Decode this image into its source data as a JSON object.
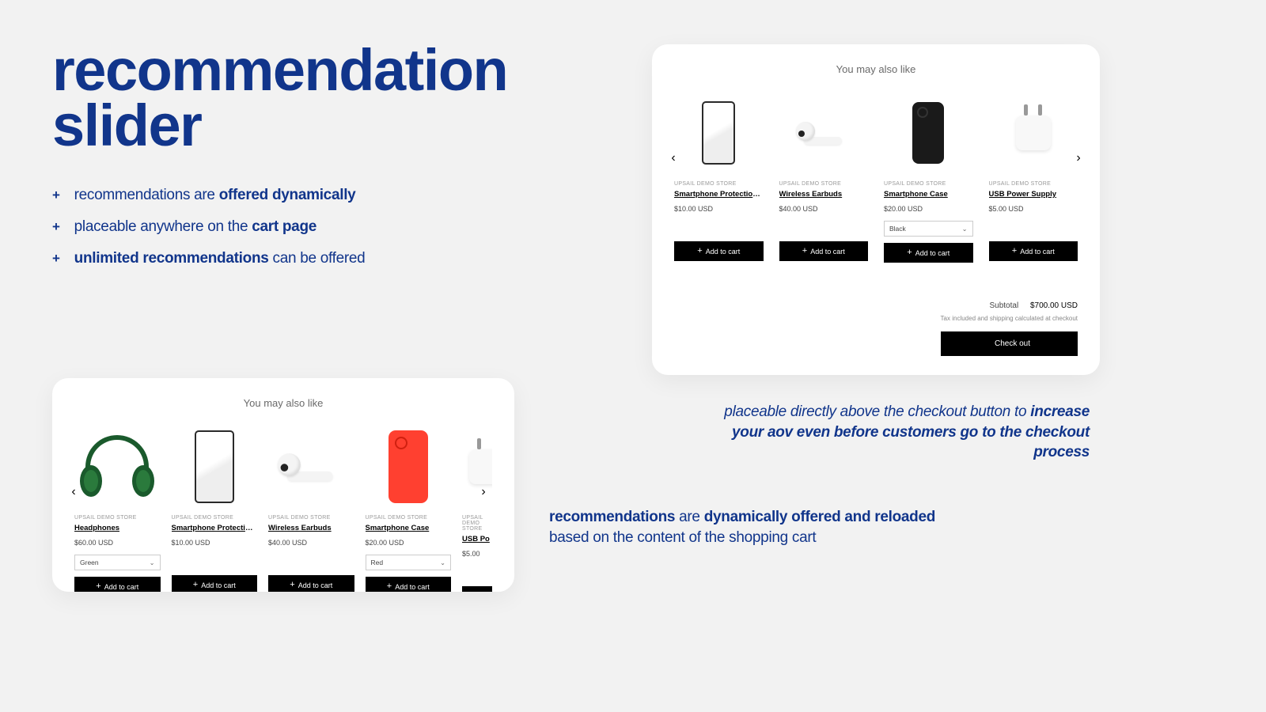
{
  "headline": {
    "line1": "recommendation",
    "line2": "slider"
  },
  "bullets": [
    {
      "pre": "recommendations are ",
      "bold": "offered dynamically",
      "post": ""
    },
    {
      "pre": "placeable anywhere on the ",
      "bold": "cart page",
      "post": ""
    },
    {
      "pre": "",
      "bold": "unlimited recommendations",
      "post": " can be offered"
    }
  ],
  "slider_title": "You may also like",
  "brand": "UPSAIL DEMO STORE",
  "add_label": "Add to cart",
  "top_slider": {
    "products": [
      {
        "name": "Smartphone Protection Glas",
        "price": "$10.00 USD"
      },
      {
        "name": "Wireless Earbuds",
        "price": "$40.00 USD"
      },
      {
        "name": "Smartphone Case",
        "price": "$20.00 USD",
        "variant": "Black"
      },
      {
        "name": "USB Power Supply",
        "price": "$5.00 USD"
      }
    ],
    "subtotal_label": "Subtotal",
    "subtotal": "$700.00 USD",
    "tax_note": "Tax included and shipping calculated at checkout",
    "checkout": "Check out"
  },
  "bottom_slider": {
    "products": [
      {
        "name": "Headphones",
        "price": "$60.00 USD",
        "variant": "Green"
      },
      {
        "name": "Smartphone Protection Glas",
        "price": "$10.00 USD"
      },
      {
        "name": "Wireless Earbuds",
        "price": "$40.00 USD"
      },
      {
        "name": "Smartphone Case",
        "price": "$20.00 USD",
        "variant": "Red"
      },
      {
        "name": "USB Po",
        "price": "$5.00"
      }
    ]
  },
  "caption_right": {
    "pre": "placeable directly above the checkout button to ",
    "bold": "increase your aov even before customers go to the checkout process"
  },
  "caption_left": {
    "bold1": "recommendations",
    "mid": " are ",
    "bold2": "dynamically offered and reloaded",
    "post": " based on the content of the shopping cart"
  }
}
